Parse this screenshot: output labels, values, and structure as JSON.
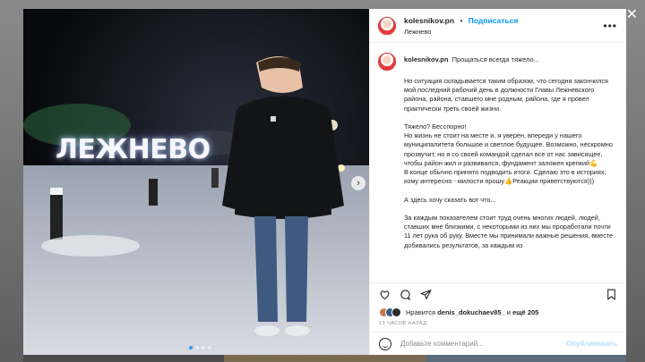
{
  "post": {
    "username": "kolesnikov.pn",
    "follow_label": "Подписаться",
    "location": "Лежнево",
    "sign_text": "ЛЕЖНЕВО",
    "caption_intro": "Прощаться всегда тяжело...",
    "caption_body": "Но ситуация складывается таким образом, что сегодня закончился мой последний рабочий день в должности Главы Лежневского района, района, ставшего мне родным, района, где я провел практически треть своей жизни.\n\nТяжело? Бесспорно!\nНо жизнь не стоит на месте и, я уверен, впереди у нашего муниципалитета большое и светлое будущее. Возможно, нескромно прозвучит, но я со своей командой сделал все от нас зависящее, чтобы район жил и развивался, фундамент заложен крепкий💪\nВ конце обычно принято подводить итоги. Сделаю это в историях, кому интересно - милости прошу👍Реакции приветствуются)))\n\nА здесь хочу сказать вот что...\n\nЗа каждым показателем стоит труд очень многих людей, людей, ставших мне близкими, с некоторыми из них мы проработали почти 11 лет рука об руку. Вместе мы принимали важные решения, вместе добивались результатов, за каждым из",
    "likes_prefix": "Нравится",
    "likes_user": "denis_dokuchaev85_",
    "likes_mid": "и",
    "likes_count": "ещё 205",
    "time_ago": "13 ЧАСОВ НАЗАД",
    "comment_placeholder": "Добавьте комментарий...",
    "publish_label": "Опубликовать",
    "close_symbol": "✕",
    "next_symbol": "›",
    "more_symbol": "•••"
  },
  "colors": {
    "link_blue": "#0095f6",
    "publish_disabled": "#b2dffc",
    "muted": "#8e8e8e"
  }
}
